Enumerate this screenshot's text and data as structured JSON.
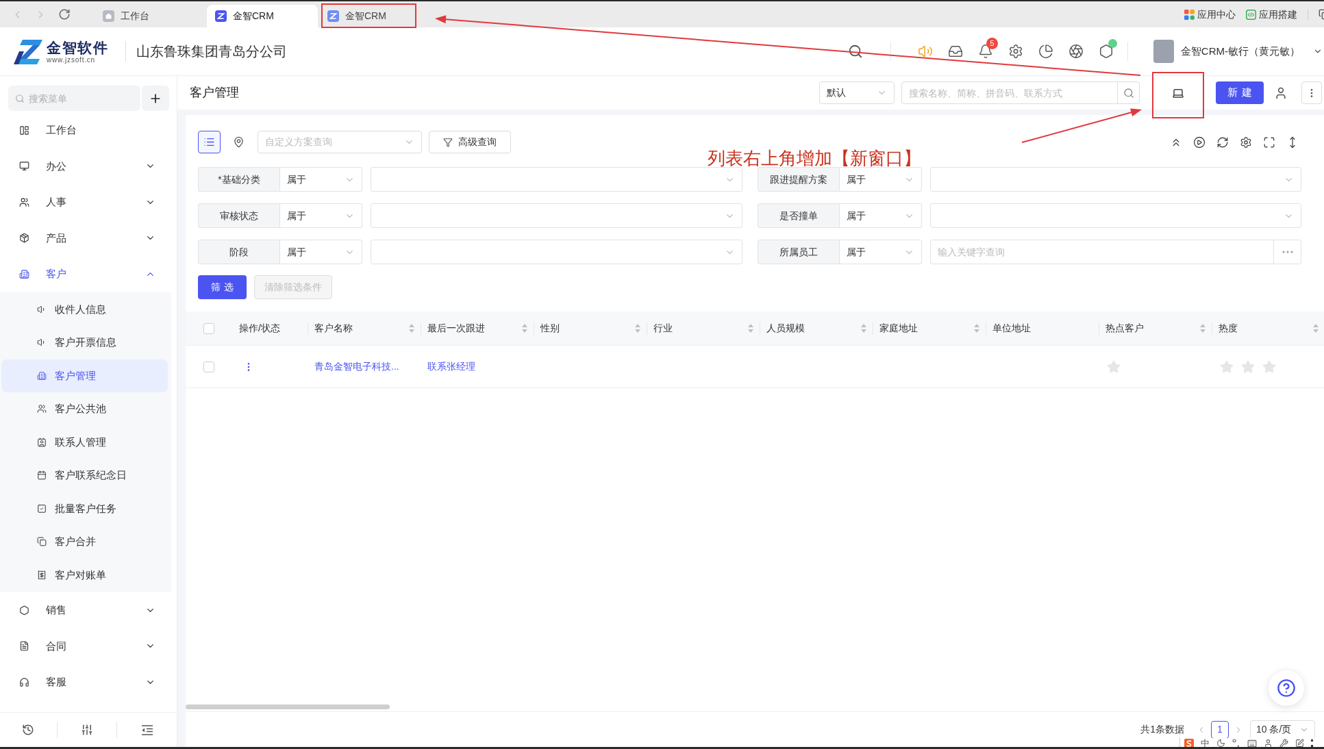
{
  "browser": {
    "tabs": [
      {
        "label": "工作台",
        "kind": "workbench",
        "selected": false
      },
      {
        "label": "金智CRM",
        "kind": "app",
        "selected": true
      },
      {
        "label": "金智CRM",
        "kind": "app",
        "selected": false
      }
    ],
    "links": [
      "应用中心",
      "应用搭建"
    ]
  },
  "header": {
    "logo": {
      "name": "金智软件",
      "url": "www.jzsoft.cn"
    },
    "company": "山东鲁珠集团青岛分公司",
    "notification_badge": "5",
    "user": "金智CRM-敏行（黄元敏）"
  },
  "sidebar": {
    "search": {
      "placeholder": "搜索菜单"
    },
    "items": [
      {
        "label": "工作台",
        "selected": false
      },
      {
        "label": "办公",
        "selected": false,
        "expanded": false
      },
      {
        "label": "人事",
        "selected": false,
        "expanded": false
      },
      {
        "label": "产品",
        "selected": false,
        "expanded": false
      },
      {
        "label": "客户",
        "selected": true,
        "expanded": true,
        "children": [
          {
            "label": "收件人信息",
            "selected": false
          },
          {
            "label": "客户开票信息",
            "selected": false
          },
          {
            "label": "客户管理",
            "selected": true
          },
          {
            "label": "客户公共池",
            "selected": false
          },
          {
            "label": "联系人管理",
            "selected": false
          },
          {
            "label": "客户联系纪念日",
            "selected": false
          },
          {
            "label": "批量客户任务",
            "selected": false
          },
          {
            "label": "客户合并",
            "selected": false
          },
          {
            "label": "客户对账单",
            "selected": false
          }
        ]
      },
      {
        "label": "销售",
        "selected": false,
        "expanded": false
      },
      {
        "label": "合同",
        "selected": false,
        "expanded": false
      },
      {
        "label": "客服",
        "selected": false,
        "expanded": false
      }
    ]
  },
  "page": {
    "title": "客户管理",
    "view_select": "默认",
    "search": {
      "placeholder": "搜索名称、简称、拼音码、联系方式"
    },
    "new_button": "新建"
  },
  "toolbar": {
    "view_modes": [
      {
        "selected": true
      },
      {
        "selected": false
      }
    ],
    "scheme": {
      "placeholder": "自定义方案查询"
    },
    "advanced_button": "高级查询"
  },
  "annotation": {
    "note": "列表右上角增加【新窗口】"
  },
  "filters": {
    "conditions": [
      {
        "label": "*基础分类",
        "operator": "属于",
        "kind": "select"
      },
      {
        "label": "跟进提醒方案",
        "operator": "属于",
        "kind": "select"
      },
      {
        "label": "审核状态",
        "operator": "属于",
        "kind": "select"
      },
      {
        "label": "是否撞单",
        "operator": "属于",
        "kind": "select"
      },
      {
        "label": "阶段",
        "operator": "属于",
        "kind": "select"
      },
      {
        "label": "所属员工",
        "operator": "属于",
        "kind": "input",
        "placeholder": "输入关键字查询"
      }
    ],
    "buttons": [
      {
        "label": "筛选",
        "disabled": false
      },
      {
        "label": "清除筛选条件",
        "disabled": true
      }
    ]
  },
  "table": {
    "select_all": {
      "checked": false
    },
    "columns": [
      {
        "label": "操作/状态",
        "sortable": false
      },
      {
        "label": "客户名称",
        "sortable": true
      },
      {
        "label": "最后一次跟进",
        "sortable": true
      },
      {
        "label": "性别",
        "sortable": true
      },
      {
        "label": "行业",
        "sortable": true
      },
      {
        "label": "人员规模",
        "sortable": true
      },
      {
        "label": "家庭地址",
        "sortable": true
      },
      {
        "label": "单位地址",
        "sortable": false
      },
      {
        "label": "热点客户",
        "sortable": true
      },
      {
        "label": "热度",
        "sortable": true
      }
    ],
    "rows": [
      {
        "checked": false,
        "customer_name": "青岛金智电子科技...",
        "last_follow_up": "联系张经理",
        "hot_customer": false,
        "heat": {
          "stars": 0
        }
      }
    ]
  },
  "pagination": {
    "total": "共1条数据",
    "pages": [
      {
        "label": "1",
        "selected": true
      }
    ],
    "page_size": "10 条/页"
  },
  "ime_toolbar": {
    "mode": "中"
  }
}
